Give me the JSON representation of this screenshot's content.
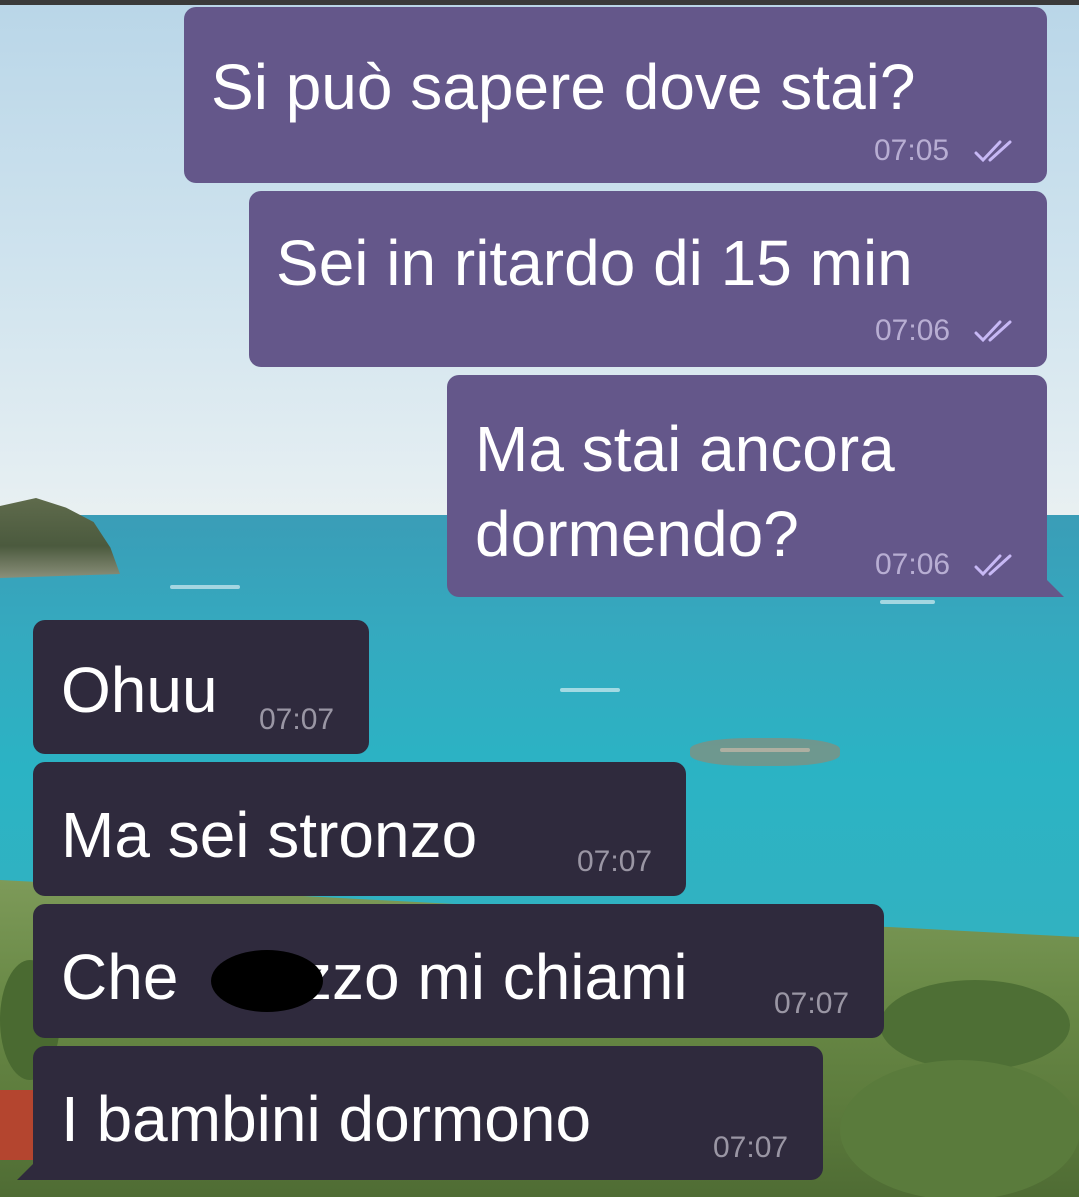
{
  "wallpaper": {
    "description_icon": "seaside-landscape-wallpaper"
  },
  "colors": {
    "outgoing_bubble": "#64578a",
    "incoming_bubble": "#2f2a3d",
    "message_text": "#ffffff",
    "read_ticks": "#c7b8f5"
  },
  "messages": [
    {
      "direction": "outgoing",
      "text": "Si può sapere dove stai?",
      "time": "07:05",
      "status": "read"
    },
    {
      "direction": "outgoing",
      "text": "Sei in ritardo di 15 min",
      "time": "07:06",
      "status": "read"
    },
    {
      "direction": "outgoing",
      "text_line1": "Ma stai ancora",
      "text_line2": "dormendo?",
      "time": "07:06",
      "status": "read"
    },
    {
      "direction": "incoming",
      "text": "Ohuu",
      "time": "07:07"
    },
    {
      "direction": "incoming",
      "text": "Ma sei stronzo",
      "time": "07:07"
    },
    {
      "direction": "incoming",
      "text_before": "Che",
      "text_after": "zzo mi chiami",
      "redacted": true,
      "time": "07:07"
    },
    {
      "direction": "incoming",
      "text": "I bambini dormono",
      "time": "07:07"
    }
  ]
}
